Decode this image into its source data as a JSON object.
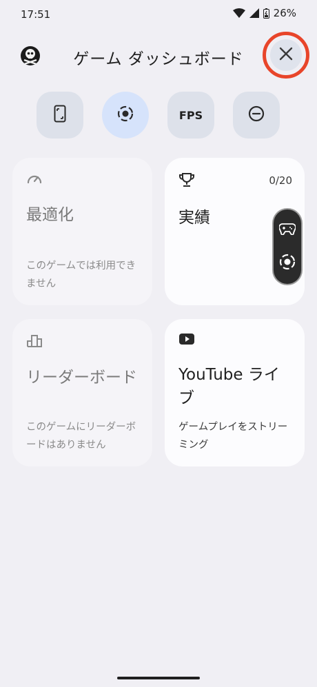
{
  "status": {
    "time": "17:51",
    "battery": "26%"
  },
  "header": {
    "title": "ゲーム ダッシュボード"
  },
  "quick_toggles": {
    "fps_label": "FPS"
  },
  "cards": {
    "optimize": {
      "title": "最適化",
      "desc": "このゲームでは利用できません"
    },
    "achievements": {
      "title": "実績",
      "count": "0/20"
    },
    "leaderboard": {
      "title": "リーダーボード",
      "desc": "このゲームにリーダーボードはありません"
    },
    "youtube": {
      "title": "YouTube ライブ",
      "desc": "ゲームプレイをストリーミング"
    }
  },
  "colors": {
    "accent_active": "#d6e3fb",
    "highlight_ring": "#e8452a"
  }
}
